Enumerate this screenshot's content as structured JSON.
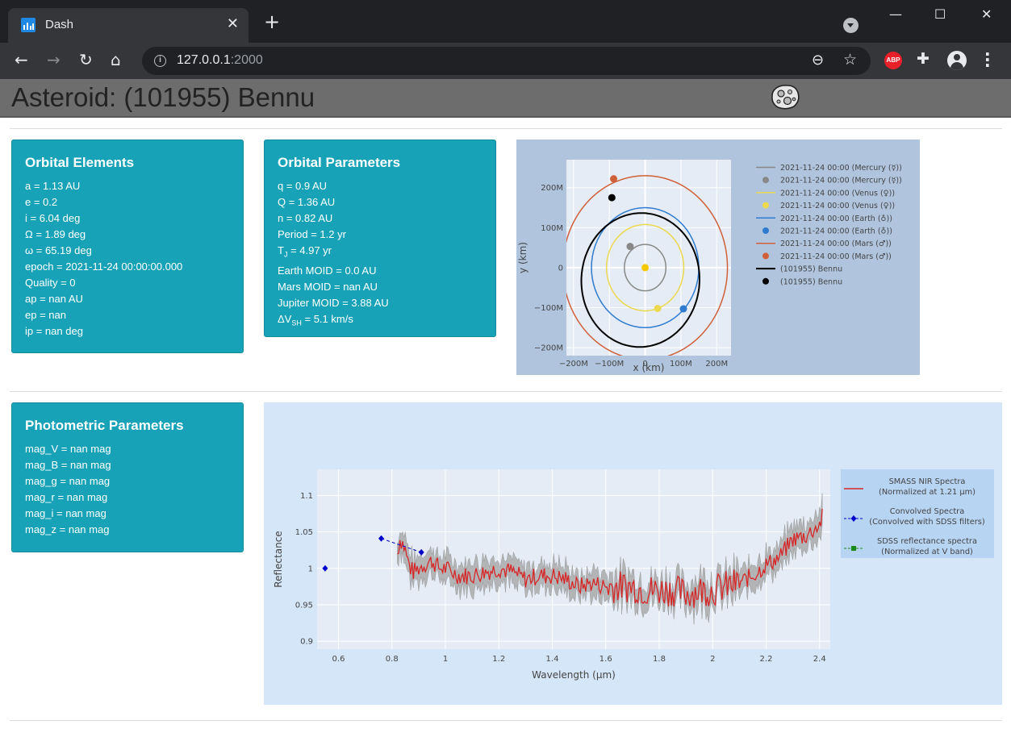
{
  "browser": {
    "tab_title": "Dash",
    "close_symbol": "✕",
    "new_tab_symbol": "+",
    "url_host": "127.0.0.1",
    "url_port": ":2000",
    "window_minimize": "—",
    "window_maximize": "☐",
    "window_close": "✕",
    "back_symbol": "←",
    "forward_symbol": "→",
    "reload_symbol": "↻",
    "home_symbol": "⌂",
    "abp_label": "ABP",
    "icons": [
      "dash-favicon",
      "tab-search-icon",
      "info-icon",
      "zoom-out-icon",
      "star-icon",
      "adblock-icon",
      "extensions-icon",
      "profile-icon",
      "menu-icon"
    ]
  },
  "page": {
    "title": "Asteroid: (101955) Bennu"
  },
  "orbital_elements": {
    "title": "Orbital Elements",
    "rows": [
      "a = 1.13 AU",
      "e = 0.2",
      "i = 6.04 deg",
      "Ω = 1.89 deg",
      "ω = 65.19 deg",
      "epoch = 2021-11-24 00:00:00.000",
      "Quality = 0",
      "ap = nan AU",
      "ep = nan",
      "ip = nan deg"
    ]
  },
  "orbital_parameters": {
    "title": "Orbital Parameters",
    "rows": [
      "q = 0.9 AU",
      "Q = 1.36 AU",
      "n = 0.82 AU",
      "Period = 1.2 yr"
    ],
    "tj_prefix": "T",
    "tj_sub": "J",
    "tj_value": " = 4.97 yr",
    "rows2": [
      "Earth MOID = 0.0 AU",
      "Mars MOID = nan AU",
      "Jupiter MOID = 3.88 AU"
    ],
    "dv_prefix": "ΔV",
    "dv_sub": "SH",
    "dv_value": " = 5.1 km/s"
  },
  "photometric": {
    "title": "Photometric Parameters",
    "rows": [
      "mag_V = nan mag",
      "mag_B = nan mag",
      "mag_g = nan mag",
      "mag_r = nan mag",
      "mag_i = nan mag",
      "mag_z = nan mag"
    ]
  },
  "chart_data": [
    {
      "type": "line",
      "xlabel": "x (km)",
      "ylabel": "y (km)",
      "xlim": [
        -220,
        240
      ],
      "ylim": [
        -220,
        270
      ],
      "x_units": "M km",
      "xticks": [
        -200,
        -100,
        0,
        100,
        200
      ],
      "xtick_labels": [
        "−200M",
        "−100M",
        "0",
        "100M",
        "200M"
      ],
      "yticks": [
        -200,
        -100,
        0,
        100,
        200
      ],
      "ytick_labels": [
        "−200M",
        "−100M",
        "0",
        "100M",
        "200M"
      ],
      "grid": true,
      "legend_placement": "right",
      "sun": {
        "x": 0,
        "y": 0,
        "color": "#f5c800"
      },
      "series": [
        {
          "name": "2021-11-24 00:00 (Mercury (☿))",
          "kind": "orbit",
          "radius": 58,
          "color": "#888888"
        },
        {
          "name": "2021-11-24 00:00 (Mercury (☿))",
          "kind": "point",
          "x": -42,
          "y": 53,
          "color": "#888888"
        },
        {
          "name": "2021-11-24 00:00 (Venus (♀))",
          "kind": "orbit",
          "radius": 108,
          "color": "#ecd94e"
        },
        {
          "name": "2021-11-24 00:00 (Venus (♀))",
          "kind": "point",
          "x": 35,
          "y": -102,
          "color": "#ecd94e"
        },
        {
          "name": "2021-11-24 00:00 (Earth (♁))",
          "kind": "orbit",
          "radius": 150,
          "color": "#2e7bcf"
        },
        {
          "name": "2021-11-24 00:00 (Earth (♁))",
          "kind": "point",
          "x": 107,
          "y": -103,
          "color": "#2e7bcf"
        },
        {
          "name": "2021-11-24 00:00 (Mars (♂))",
          "kind": "orbit",
          "radius": 230,
          "color": "#d0603a"
        },
        {
          "name": "2021-11-24 00:00 (Mars (♂))",
          "kind": "point",
          "x": -88,
          "y": 222,
          "color": "#d0603a"
        },
        {
          "name": "(101955) Bennu",
          "kind": "ellipse",
          "a": 168,
          "e": 0.2,
          "omega_deg": 67,
          "color": "#000000"
        },
        {
          "name": "(101955) Bennu",
          "kind": "point",
          "x": -93,
          "y": 175,
          "color": "#000000"
        }
      ]
    },
    {
      "type": "line",
      "xlabel": "Wavelength (µm)",
      "ylabel": "Reflectance",
      "xlim": [
        0.52,
        2.44
      ],
      "ylim": [
        0.889,
        1.136
      ],
      "xticks": [
        0.6,
        0.8,
        1,
        1.2,
        1.4,
        1.6,
        1.8,
        2,
        2.2,
        2.4
      ],
      "xtick_labels": [
        "0.6",
        "0.8",
        "1",
        "1.2",
        "1.4",
        "1.6",
        "1.8",
        "2",
        "2.2",
        "2.4"
      ],
      "yticks": [
        0.9,
        0.95,
        1,
        1.05,
        1.1
      ],
      "ytick_labels": [
        "0.9",
        "0.95",
        "1",
        "1.05",
        "1.1"
      ],
      "grid": true,
      "legend_placement": "right",
      "legend": [
        {
          "line1": "SMASS NIR Spectra",
          "line2": "(Normalized at 1.21 µm)",
          "color": "#d62728",
          "marker": "none"
        },
        {
          "line1": "Convolved Spectra",
          "line2": "(Convolved with SDSS filters)",
          "color": "#0000cc",
          "marker": "diamond"
        },
        {
          "line1": "SDSS reflectance spectra",
          "line2": "(Normalized at V band)",
          "color": "#1a8a1a",
          "marker": "square"
        }
      ],
      "series": [
        {
          "name": "SMASS NIR Spectra (Normalized at 1.21 µm)",
          "color": "#d62728",
          "band_color": "#aaaaaa",
          "x": [
            0.82,
            0.83,
            0.84,
            0.85,
            0.86,
            0.87,
            0.88,
            0.9,
            0.92,
            0.95,
            0.98,
            1.0,
            1.05,
            1.1,
            1.15,
            1.2,
            1.25,
            1.3,
            1.35,
            1.4,
            1.45,
            1.5,
            1.55,
            1.6,
            1.65,
            1.7,
            1.75,
            1.8,
            1.85,
            1.9,
            1.95,
            2.0,
            2.05,
            2.1,
            2.15,
            2.2,
            2.25,
            2.3,
            2.35,
            2.4,
            2.41
          ],
          "y": [
            1.02,
            1.04,
            1.035,
            1.025,
            1.01,
            1.0,
            0.995,
            1.0,
            1.005,
            1.01,
            1.0,
            1.0,
            0.99,
            0.99,
            0.995,
            1.0,
            0.995,
            0.985,
            0.99,
            0.99,
            0.985,
            0.975,
            0.98,
            0.975,
            0.975,
            0.975,
            0.97,
            0.97,
            0.97,
            0.965,
            0.97,
            0.97,
            0.975,
            0.98,
            0.99,
            1.005,
            1.015,
            1.04,
            1.045,
            1.06,
            1.07
          ],
          "band": 0.018
        },
        {
          "name": "Convolved Spectra (Convolved with SDSS filters)",
          "color": "#0000cc",
          "x": [
            0.55,
            0.76,
            0.91
          ],
          "y": [
            1.0,
            1.041,
            1.022
          ]
        }
      ]
    }
  ]
}
